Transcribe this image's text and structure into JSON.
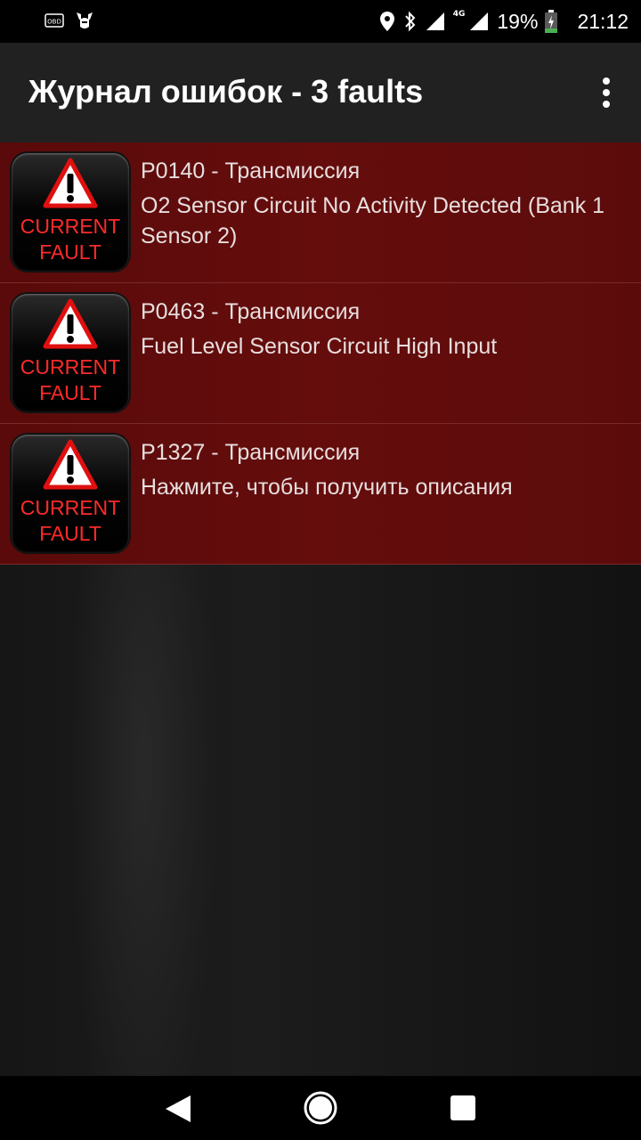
{
  "status_bar": {
    "obd_label": "OBD",
    "battery_percent": "19%",
    "time": "21:12",
    "network_label": "4G"
  },
  "app_bar": {
    "title": "Журнал ошибок - 3 faults"
  },
  "faults": [
    {
      "code": "P0140 - Трансмиссия",
      "description": "O2 Sensor Circuit No Activity Detected (Bank 1 Sensor 2)",
      "badge_line1": "CURRENT",
      "badge_line2": "FAULT"
    },
    {
      "code": "P0463 - Трансмиссия",
      "description": "Fuel Level Sensor Circuit High Input",
      "badge_line1": "CURRENT",
      "badge_line2": "FAULT"
    },
    {
      "code": "P1327 - Трансмиссия",
      "description": "Нажмите, чтобы получить описания",
      "badge_line1": "CURRENT",
      "badge_line2": "FAULT"
    }
  ],
  "colors": {
    "row_bg": "#600c0c",
    "badge_text": "#ff2a2a",
    "appbar_bg": "#212121",
    "battery_fill": "#4caf50"
  },
  "icons": {
    "warning": "warning-triangle-icon",
    "location": "location-icon",
    "bluetooth": "bluetooth-icon",
    "signal": "signal-icon",
    "battery": "battery-charging-icon",
    "overflow": "more-vert-icon"
  }
}
